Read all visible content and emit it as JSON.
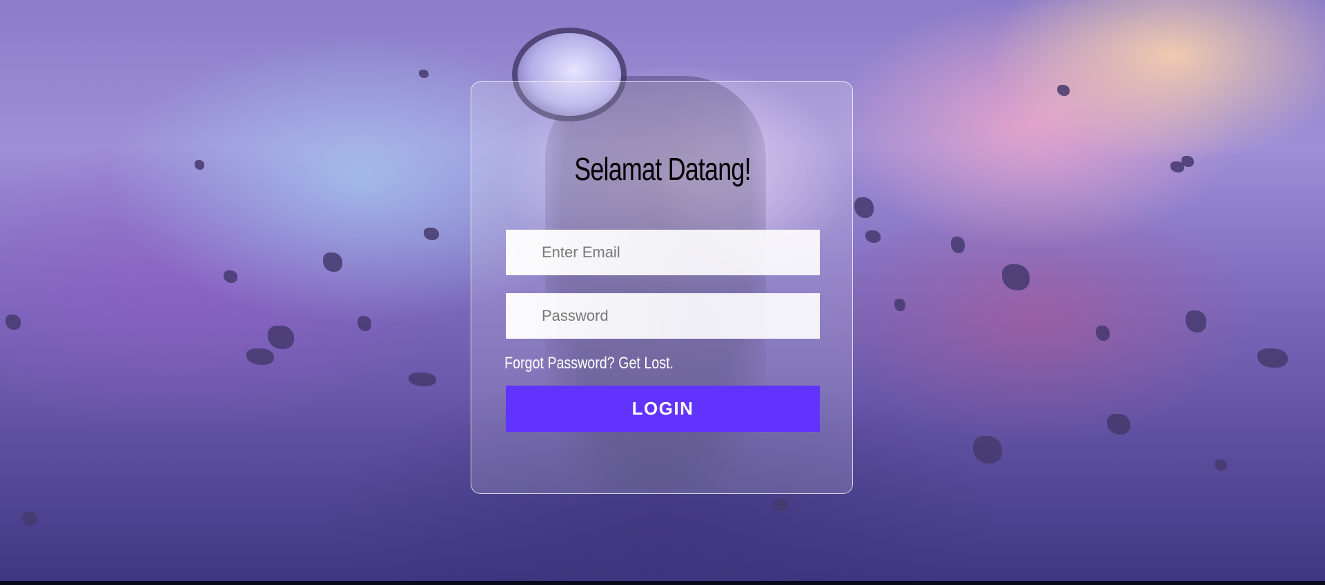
{
  "title": "Selamat Datang!",
  "form": {
    "email_placeholder": "Enter Email",
    "email_value": "",
    "password_placeholder": "Password",
    "password_value": "",
    "forgot_link": "Forgot Password? Get Lost.",
    "login_label": "LOGIN"
  },
  "colors": {
    "login_button": "#6233ff",
    "title_text": "#000000",
    "link_text": "#ffffff"
  }
}
